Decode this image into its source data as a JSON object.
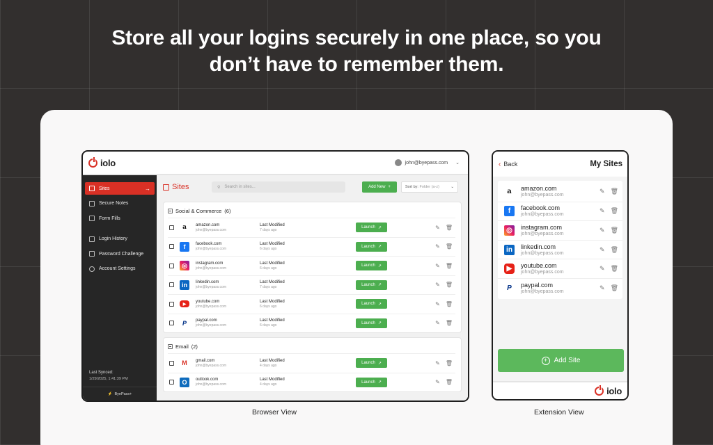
{
  "headline": {
    "line1": "Store all your logins securely in one place, so you",
    "line2": "don’t have to remember them."
  },
  "brand": {
    "name": "iolo",
    "color": "#d93025"
  },
  "accent_green": "#4cae4f",
  "browser": {
    "caption": "Browser View",
    "user_email": "john@byepass.com",
    "sidebar": {
      "items": [
        {
          "label": "Sites",
          "icon": "calendar-icon",
          "active": true
        },
        {
          "label": "Secure Notes",
          "icon": "notes-icon"
        },
        {
          "label": "Form Fills",
          "icon": "form-icon"
        },
        {
          "label": "Login History",
          "icon": "history-icon"
        },
        {
          "label": "Password Challenge",
          "icon": "challenge-icon"
        },
        {
          "label": "Account Settings",
          "icon": "user-icon"
        }
      ],
      "last_synced_label": "Last Synced:",
      "last_synced_value": "1/29/2025, 1:41:39 PM",
      "footer": "ByePass+"
    },
    "main": {
      "title": "Sites",
      "search_placeholder": "Search in sites...",
      "add_new": "Add New",
      "sort_label": "Sort by:",
      "sort_value": "Folder (a-z)",
      "groups": [
        {
          "name": "Social & Commerce",
          "count": "(6)",
          "rows": [
            {
              "site": "amazon.com",
              "email": "john@byepass.com",
              "modified_label": "Last Modified",
              "modified": "7 days ago",
              "logo": "a"
            },
            {
              "site": "facebook.com",
              "email": "john@byepass.com",
              "modified_label": "Last Modified",
              "modified": "6 days ago",
              "logo": "f"
            },
            {
              "site": "instagram.com",
              "email": "john@byepass.com",
              "modified_label": "Last Modified",
              "modified": "6 days ago",
              "logo": "◎"
            },
            {
              "site": "linkedin.com",
              "email": "john@byepass.com",
              "modified_label": "Last Modified",
              "modified": "7 days ago",
              "logo": "in"
            },
            {
              "site": "youtube.com",
              "email": "john@byepass.com",
              "modified_label": "Last Modified",
              "modified": "6 days ago",
              "logo": "▶"
            },
            {
              "site": "paypal.com",
              "email": "john@byepass.com",
              "modified_label": "Last Modified",
              "modified": "6 days ago",
              "logo": "P"
            }
          ]
        },
        {
          "name": "Email",
          "count": "(2)",
          "rows": [
            {
              "site": "gmail.com",
              "email": "john@byepass.com",
              "modified_label": "Last Modified",
              "modified": "4 days ago",
              "logo": "M"
            },
            {
              "site": "outlook.com",
              "email": "john@byepass.com",
              "modified_label": "Last Modified",
              "modified": "4 days ago",
              "logo": "O"
            }
          ]
        }
      ],
      "launch_label": "Launch"
    }
  },
  "extension": {
    "caption": "Extension View",
    "back": "Back",
    "title": "My Sites",
    "rows": [
      {
        "site": "amazon.com",
        "email": "john@byepass.com",
        "logo": "a"
      },
      {
        "site": "facebook.com",
        "email": "john@byepass.com",
        "logo": "f"
      },
      {
        "site": "instagram.com",
        "email": "john@byepass.com",
        "logo": "◎"
      },
      {
        "site": "linkedin.com",
        "email": "john@byepass.com",
        "logo": "in"
      },
      {
        "site": "youtube.com",
        "email": "john@byepass.com",
        "logo": "▶"
      },
      {
        "site": "paypal.com",
        "email": "john@byepass.com",
        "logo": "P"
      }
    ],
    "add_site": "Add Site"
  }
}
